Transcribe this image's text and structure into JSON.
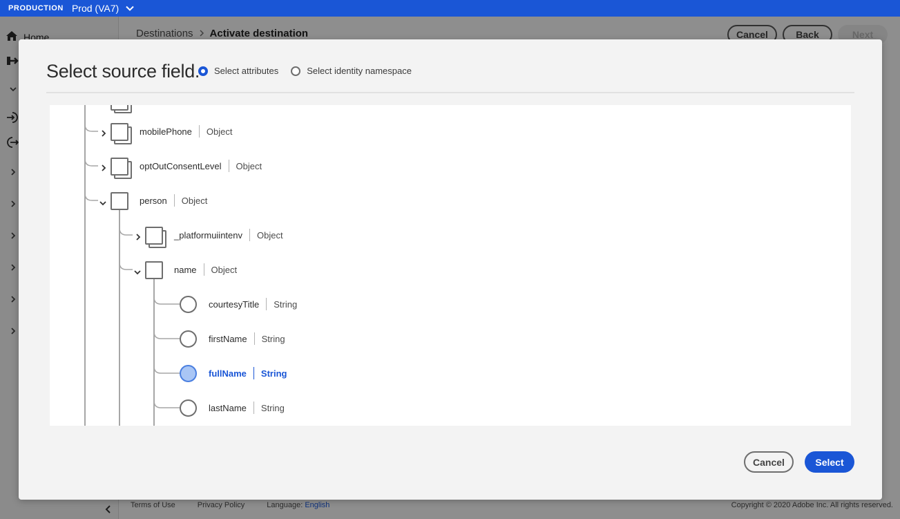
{
  "topbar": {
    "environment": "PRODUCTION",
    "sandbox": "Prod (VA7)"
  },
  "sidebar": {
    "home_label": "Home"
  },
  "page": {
    "breadcrumb": {
      "parent": "Destinations",
      "current": "Activate destination"
    },
    "buttons": {
      "cancel": "Cancel",
      "back": "Back",
      "next": "Next"
    }
  },
  "footer": {
    "terms": "Terms of Use",
    "privacy": "Privacy Policy",
    "language_label": "Language:",
    "language_value": "English",
    "copyright": "Copyright © 2020 Adobe Inc. All rights reserved."
  },
  "modal": {
    "title": "Select source field.",
    "radio_options": [
      {
        "label": "Select attributes",
        "selected": true
      },
      {
        "label": "Select identity namespace",
        "selected": false
      }
    ],
    "tree": [
      {
        "name": "mobilePhone",
        "type": "Object",
        "kind": "object",
        "expanded": false
      },
      {
        "name": "optOutConsentLevel",
        "type": "Object",
        "kind": "object",
        "expanded": false
      },
      {
        "name": "person",
        "type": "Object",
        "kind": "object",
        "expanded": true
      },
      {
        "name": "_platformuiintenv",
        "type": "Object",
        "kind": "object",
        "expanded": false
      },
      {
        "name": "name",
        "type": "Object",
        "kind": "object",
        "expanded": true
      },
      {
        "name": "courtesyTitle",
        "type": "String",
        "kind": "field"
      },
      {
        "name": "firstName",
        "type": "String",
        "kind": "field"
      },
      {
        "name": "fullName",
        "type": "String",
        "kind": "field",
        "selected": true
      },
      {
        "name": "lastName",
        "type": "String",
        "kind": "field"
      }
    ],
    "buttons": {
      "cancel": "Cancel",
      "select": "Select"
    }
  },
  "colors": {
    "accent": "#1a56d6",
    "selected_fill": "#a9c6f5"
  }
}
